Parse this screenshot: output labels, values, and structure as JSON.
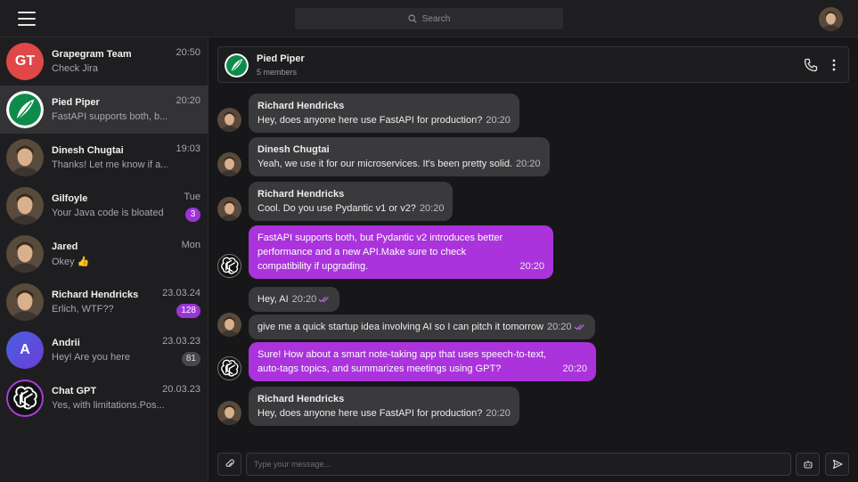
{
  "search": {
    "placeholder": "Search"
  },
  "colors": {
    "accent": "#aa33dc",
    "badge": "#9b35d6",
    "active_row": "#333336"
  },
  "sidebar": {
    "chats": [
      {
        "name": "Grapegram Team",
        "preview": "Check Jira",
        "time": "20:50",
        "badge": "",
        "avatar_text": "GT",
        "avatar_icon": "initials-avatar"
      },
      {
        "name": "Pied Piper",
        "preview": "FastAPI supports both, b...",
        "time": "20:20",
        "badge": "",
        "avatar_icon": "pied-piper-logo-icon"
      },
      {
        "name": "Dinesh Chugtai",
        "preview": "Thanks! Let me know if a...",
        "time": "19:03",
        "badge": "",
        "avatar_icon": "person-photo-avatar"
      },
      {
        "name": "Gilfoyle",
        "preview": "Your Java code is bloated",
        "time": "Tue",
        "badge": "3",
        "avatar_icon": "person-photo-avatar"
      },
      {
        "name": "Jared",
        "preview": "Okey 👍",
        "time": "Mon",
        "badge": "",
        "avatar_icon": "person-photo-avatar"
      },
      {
        "name": "Richard Hendricks",
        "preview": "Erlich, WTF??",
        "time": "23.03.24",
        "badge": "128",
        "avatar_icon": "person-photo-avatar"
      },
      {
        "name": "Andrii",
        "preview": "Hey! Are you here",
        "time": "23.03.23",
        "badge": "81",
        "avatar_text": "A",
        "avatar_icon": "initials-avatar"
      },
      {
        "name": "Chat GPT",
        "preview": "Yes, with limitations.Pos...",
        "time": "20.03.23",
        "badge": "",
        "avatar_icon": "openai-logo-icon"
      }
    ]
  },
  "header": {
    "title": "Pied Piper",
    "subtitle": "5 members"
  },
  "messages": [
    {
      "sender": "Richard Hendricks",
      "text": "Hey, does anyone here use FastAPI for production?",
      "time": "20:20"
    },
    {
      "sender": "Dinesh Chugtai",
      "text": "Yeah, we use it for our microservices. It's been pretty solid.",
      "time": "20:20"
    },
    {
      "sender": "Richard Hendricks",
      "text": "Cool. Do you use Pydantic v1 or v2?",
      "time": "20:20"
    },
    {
      "sender": "",
      "lines": [
        "FastAPI supports both, but Pydantic v2 introduces better",
        "performance and a new API.Make sure to check",
        "compatibility if upgrading."
      ],
      "time": "20:20"
    },
    {
      "sender": "",
      "text": "Hey, AI",
      "time": "20:20"
    },
    {
      "sender": "",
      "text": "give me a quick startup idea involving AI so I can pitch it tomorrow",
      "time": "20:20"
    },
    {
      "sender": "",
      "lines": [
        "Sure! How about a smart note-taking app that uses speech-to-text,",
        "auto-tags topics, and summarizes meetings using GPT?"
      ],
      "time": "20:20"
    },
    {
      "sender": "Richard Hendricks",
      "text": "Hey, does anyone here use FastAPI for production?",
      "time": "20:20"
    }
  ],
  "composer": {
    "placeholder": "Type your message..."
  }
}
